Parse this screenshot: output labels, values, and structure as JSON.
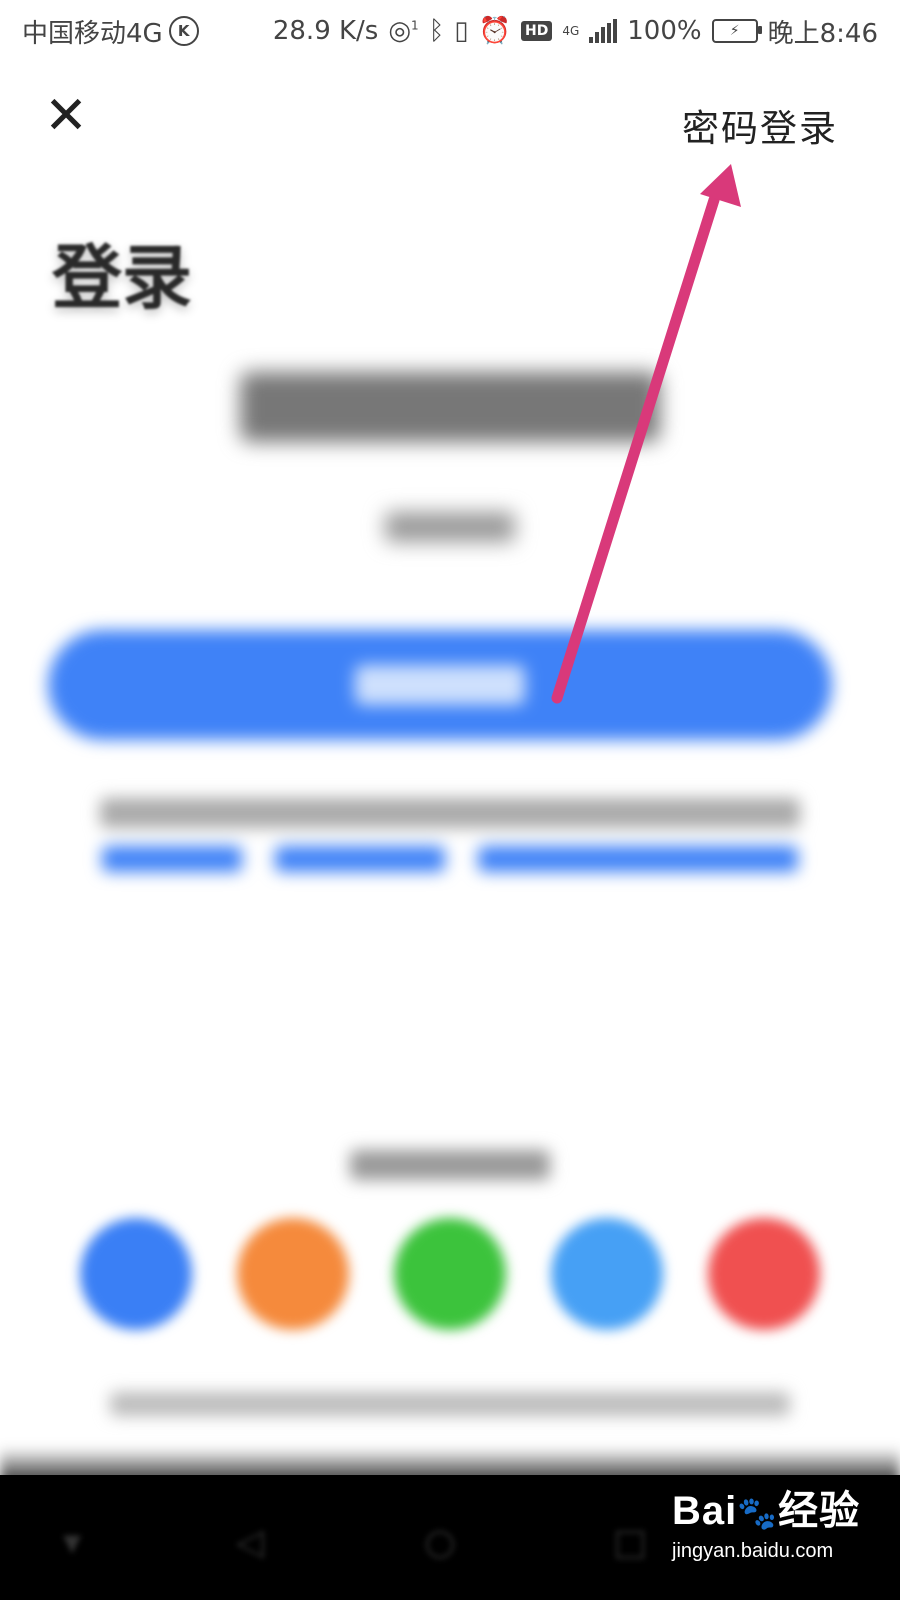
{
  "status_bar": {
    "carrier": "中国移动4G",
    "carrier_badge": "K",
    "net_speed": "28.9 K/s",
    "hotspot_badge": "1",
    "hd_label": "HD",
    "network_type": "4G",
    "battery_percent": "100%",
    "time": "晚上8:46"
  },
  "header": {
    "password_login_label": "密码登录"
  },
  "page": {
    "title": "登录"
  },
  "watermark": {
    "logo_text": "Bai",
    "logo_text_end": "经验",
    "sub": "jingyan.baidu.com"
  },
  "colors": {
    "primary_button": "#3f82f7",
    "annotation_arrow": "#d9397a",
    "social": [
      "#3a7ff5",
      "#f58a3c",
      "#3cc33c",
      "#46a0f5",
      "#f05050"
    ]
  }
}
